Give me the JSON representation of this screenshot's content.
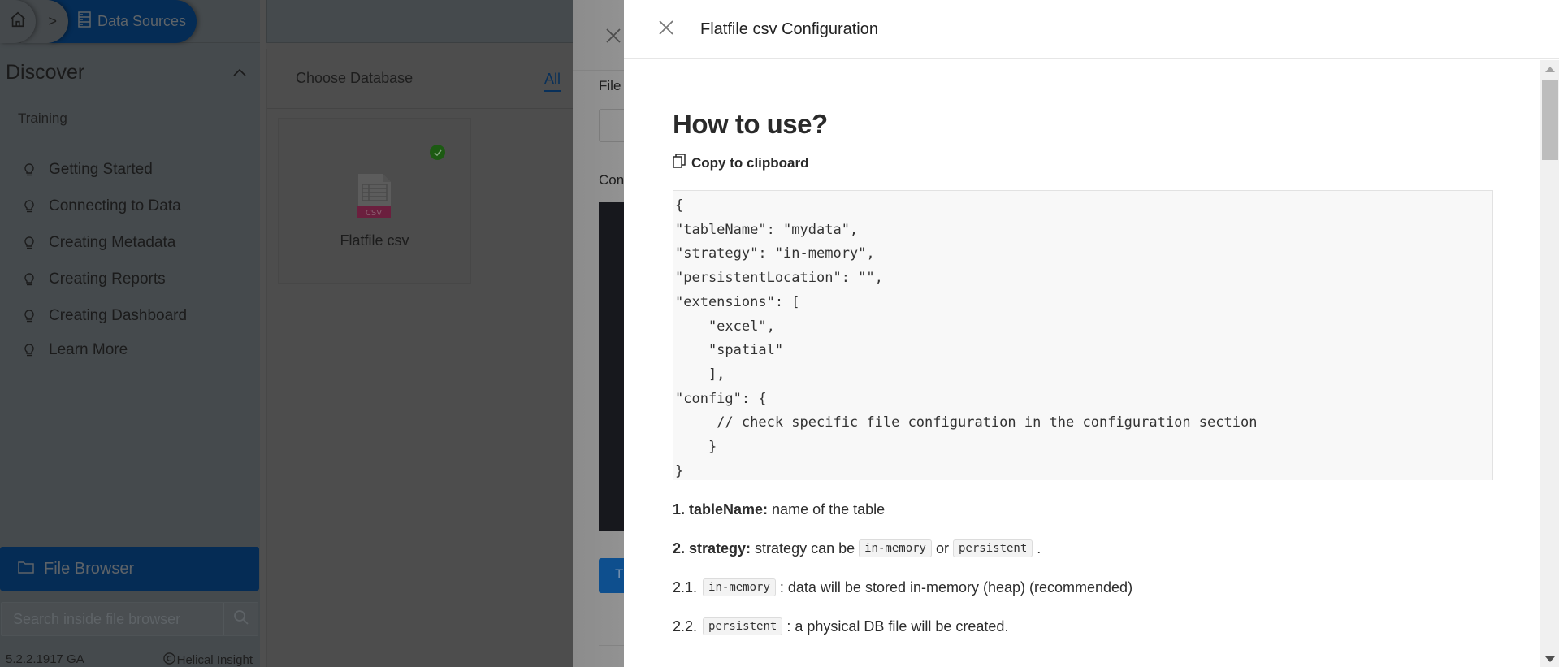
{
  "breadcrumb": {
    "home_icon": "home-icon",
    "separator": ">",
    "current": "Data Sources",
    "current_icon": "database-icon"
  },
  "sidebar": {
    "section_title": "Discover",
    "collapse_icon": "chevron-up-icon",
    "group_label": "Training",
    "items": [
      {
        "label": "Getting Started",
        "icon": "lightbulb-icon"
      },
      {
        "label": "Connecting to Data",
        "icon": "lightbulb-icon"
      },
      {
        "label": "Creating Metadata",
        "icon": "lightbulb-icon"
      },
      {
        "label": "Creating Reports",
        "icon": "lightbulb-icon"
      },
      {
        "label": "Creating Dashboard",
        "icon": "lightbulb-icon"
      },
      {
        "label": "Learn More",
        "icon": "lightbulb-icon"
      }
    ],
    "file_browser": {
      "label": "File Browser",
      "icon": "folder-icon"
    },
    "search": {
      "placeholder": "Search inside file browser",
      "value": "",
      "icon": "search-icon"
    },
    "version": "5.2.2.1917 GA",
    "copyright_symbol": "©",
    "copyright": "Helical Insight"
  },
  "database_panel": {
    "title": "Choose Database",
    "tab_all": "All",
    "cards": [
      {
        "label": "Flatfile csv",
        "icon": "csv-file-icon",
        "icon_text": "CSV",
        "selected": true
      }
    ]
  },
  "datasource_drawer": {
    "close_icon": "close-icon",
    "field_label_partial": "File",
    "config_label_partial": "Con",
    "button_partial": "T"
  },
  "config_drawer": {
    "title": "Flatfile csv Configuration",
    "heading": "How to use?",
    "copy_label": "Copy to clipboard",
    "code_lines": [
      "{",
      "\"tableName\": \"mydata\",",
      "\"strategy\": \"in-memory\",",
      "\"persistentLocation\": \"\",",
      "\"extensions\": [",
      "    \"excel\",",
      "    \"spatial\"",
      "    ],",
      "\"config\": {",
      "     // check specific file configuration in the configuration section",
      "    }",
      "}"
    ],
    "docs": {
      "p1_bold": "1. tableName:",
      "p1_text": "name of the table",
      "p2_bold": "2. strategy:",
      "p2_text": "strategy can be",
      "p2_code1": "in-memory",
      "p2_or": "or",
      "p2_code2": "persistent",
      "p2_end": ".",
      "p21_num": "2.1.",
      "p21_code": "in-memory",
      "p21_text": ": data will be stored in-memory (heap) (recommended)",
      "p22_num": "2.2.",
      "p22_code": "persistent",
      "p22_text": ": a physical DB file will be created."
    }
  }
}
